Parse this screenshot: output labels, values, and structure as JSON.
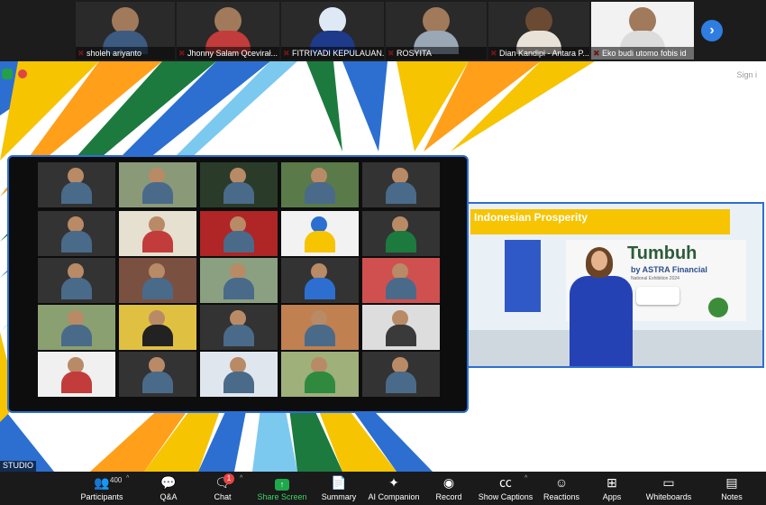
{
  "top_strip": {
    "participants": [
      {
        "name": "sholeh ariyanto"
      },
      {
        "name": "Jhonny Salam Qcevirał..."
      },
      {
        "name": "FITRIYADI KEPULAUAN..."
      },
      {
        "name": "ROSYITA"
      },
      {
        "name": "Dian Kandipi - Antara P..."
      },
      {
        "name": "Eko budi utomo fobis id"
      }
    ],
    "next_icon": "chevron-right-icon",
    "raised_hand_icon": "raised-hand-icon"
  },
  "stage": {
    "sign_in_label": "Sign i",
    "studio_label": "STUDIO"
  },
  "promo": {
    "banner_title": "Indonesian Prosperity",
    "logo_main": "Tumbuh",
    "logo_sub": "by ASTRA Financial",
    "logo_tagline": "National Exhibition 2024",
    "colors": {
      "banner": "#f6c400",
      "presenter_outfit": "#2542b5"
    }
  },
  "toolbar": {
    "participants": {
      "label": "Participants",
      "count": "400"
    },
    "qa": {
      "label": "Q&A"
    },
    "chat": {
      "label": "Chat",
      "badge": "1"
    },
    "share": {
      "label": "Share Screen"
    },
    "summary": {
      "label": "Summary"
    },
    "ai": {
      "label": "AI Companion"
    },
    "record": {
      "label": "Record"
    },
    "captions": {
      "label": "Show Captions"
    },
    "reactions": {
      "label": "Reactions"
    },
    "apps": {
      "label": "Apps"
    },
    "whiteboards": {
      "label": "Whiteboards"
    },
    "notes": {
      "label": "Notes"
    }
  }
}
